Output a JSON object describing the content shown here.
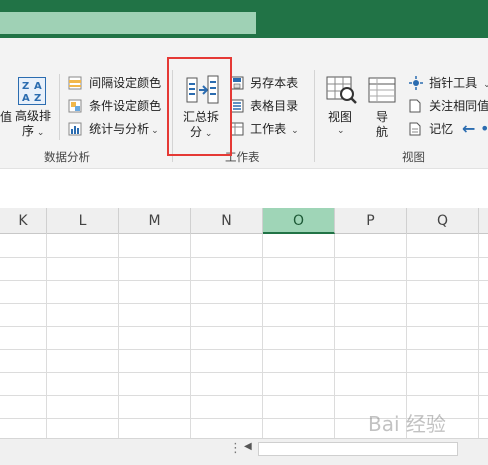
{
  "colors": {
    "brand": "#217346",
    "title_field": "#9fd1b5",
    "selected_col": "#9fd5b7",
    "highlight": "#e53935"
  },
  "ribbon": {
    "data_analysis": {
      "sort_label_line1": "高级排",
      "sort_label_line2": "序",
      "cut_label": "值",
      "items": [
        "间隔设定颜色",
        "条件设定颜色",
        "统计与分析"
      ],
      "group_label": "数据分析"
    },
    "worksheet": {
      "summary_split_line1": "汇总拆",
      "summary_split_line2": "分",
      "items": [
        "另存本表",
        "表格目录",
        "工作表"
      ],
      "group_label": "工作表"
    },
    "view": {
      "view_label": "视图",
      "nav_line1": "导",
      "nav_line2": "航",
      "items": [
        "指针工具",
        "关注相同值",
        "记忆"
      ],
      "group_label": "视图"
    }
  },
  "sheet": {
    "columns": [
      "K",
      "L",
      "M",
      "N",
      "O",
      "P",
      "Q"
    ],
    "selected_column": "O"
  },
  "watermark": "Bai 经验"
}
